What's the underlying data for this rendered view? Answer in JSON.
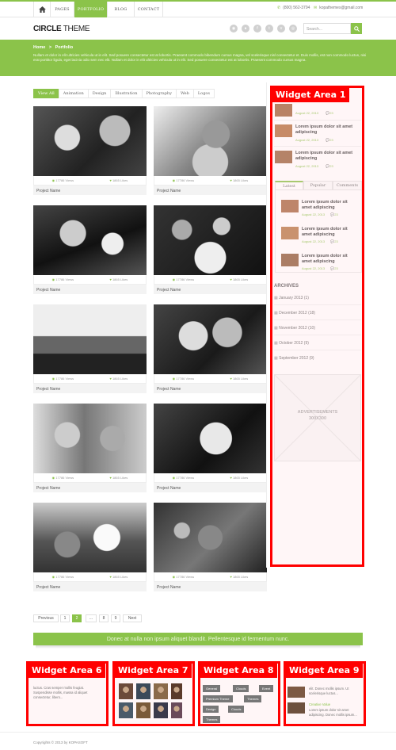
{
  "nav": {
    "items": [
      "PAGES",
      "PORTFOLIO",
      "BLOG",
      "CONTACT"
    ],
    "phone": "(800) 562-3794",
    "email": "kopathemes@gmail.com"
  },
  "header": {
    "logo_bold": "CIRCLE",
    "logo_light": " THEME",
    "search_placeholder": "Search...",
    "social_icons": [
      "rss-icon",
      "twitter-icon",
      "facebook-icon",
      "vimeo-icon",
      "dribbble-icon",
      "flickr-icon"
    ]
  },
  "banner": {
    "breadcrumb_home": "Home",
    "breadcrumb_sep": ">",
    "breadcrumb_current": "Portfolio",
    "text": "Nullam et dolor in elit ultricies vehicula ut in elit. Sed posuere consectetur est at lobortis. Praesent commodo bibendum cursus magna, vel scelerisque nisl consectetur et. Duis mollis, est non commodo luctus, nisi erat porttitor ligula, eget lacinia odio sem nec elit. Nullam et dolor in elit ultricies vehicula ut in elit. Sed posuere consectetur est at lobortis. Praesent commodo cursus magna."
  },
  "filters": [
    "View All",
    "Animation",
    "Design",
    "Illustration",
    "Photography",
    "Web",
    "Logos"
  ],
  "portfolio": {
    "views_label": "17786 Views",
    "likes_label": "1865 Likes",
    "items": [
      {
        "name": "Project Name",
        "photo": "baby-smiling"
      },
      {
        "name": "Project Name",
        "photo": "photographer"
      },
      {
        "name": "Project Name",
        "photo": "woman-drinking"
      },
      {
        "name": "Project Name",
        "photo": "group-money-shirt"
      },
      {
        "name": "Project Name",
        "photo": "boat"
      },
      {
        "name": "Project Name",
        "photo": "couple-kissing"
      },
      {
        "name": "Project Name",
        "photo": "mother-daughter"
      },
      {
        "name": "Project Name",
        "photo": "newborn"
      },
      {
        "name": "Project Name",
        "photo": "bride-dancing"
      },
      {
        "name": "Project Name",
        "photo": "child-running"
      }
    ]
  },
  "pagination": [
    "Previous",
    "1",
    "2",
    "...",
    "8",
    "9",
    "Next"
  ],
  "callout": "Donec at nulla non ipsum aliquet blandit. Pellentesque id fermentum nunc.",
  "sidebar": {
    "posts_top": [
      {
        "title": "",
        "date": "August 22, 2013",
        "comments": "23"
      },
      {
        "title": "Lorem ipsum dolor sit amet adipiscing",
        "date": "August 22, 2013",
        "comments": "23"
      },
      {
        "title": "Lorem ipsum dolor sit amet adipiscing",
        "date": "August 22, 2013",
        "comments": "23"
      }
    ],
    "tabs": [
      "Latest",
      "Popular",
      "Comments"
    ],
    "posts_tab": [
      {
        "title": "Lorem ipsum dolor sit amet adipiscing",
        "date": "August 22, 2013",
        "comments": "23"
      },
      {
        "title": "Lorem ipsum dolor sit amet adipiscing",
        "date": "August 22, 2013",
        "comments": "23"
      },
      {
        "title": "Lorem ipsum dolor sit amet adipiscing",
        "date": "August 22, 2013",
        "comments": "23"
      }
    ],
    "archives_title": "ARCHIVES",
    "archives": [
      "January 2013 (1)",
      "December 2012 (18)",
      "November 2012 (10)",
      "October 2012 (9)",
      "September 2012 (9)"
    ],
    "ad_title": "ADVERTISEMENTS",
    "ad_size": "300X300"
  },
  "widgets": {
    "area1": "Widget Area 1",
    "area6": "Widget Area 6",
    "area7": "Widget Area 7",
    "area8": "Widget Area 8",
    "area9": "Widget Area 9",
    "area6_text": "luctus. Cras semper mollis feugiat. Suspendisse mollis, massa id aliquet consectetur, libero...",
    "area9_text": "elit. Donec mollis ipsum. Ut scelerisque luctus...",
    "area9_link": "Creative Value",
    "area9_text2": "Lorem ipsum dolor sit amet adipiscing. Donec mollis ipsum...",
    "tags": [
      "General",
      "Clouds",
      "Event",
      "Premium Theme",
      "Themes",
      "Design",
      "Clouds",
      "Themes"
    ]
  },
  "footer": {
    "copyright": "Copyrights © 2013 by KOPASOFT"
  },
  "colors": {
    "accent": "#8bc34a",
    "widget_red": "#ff0000"
  }
}
